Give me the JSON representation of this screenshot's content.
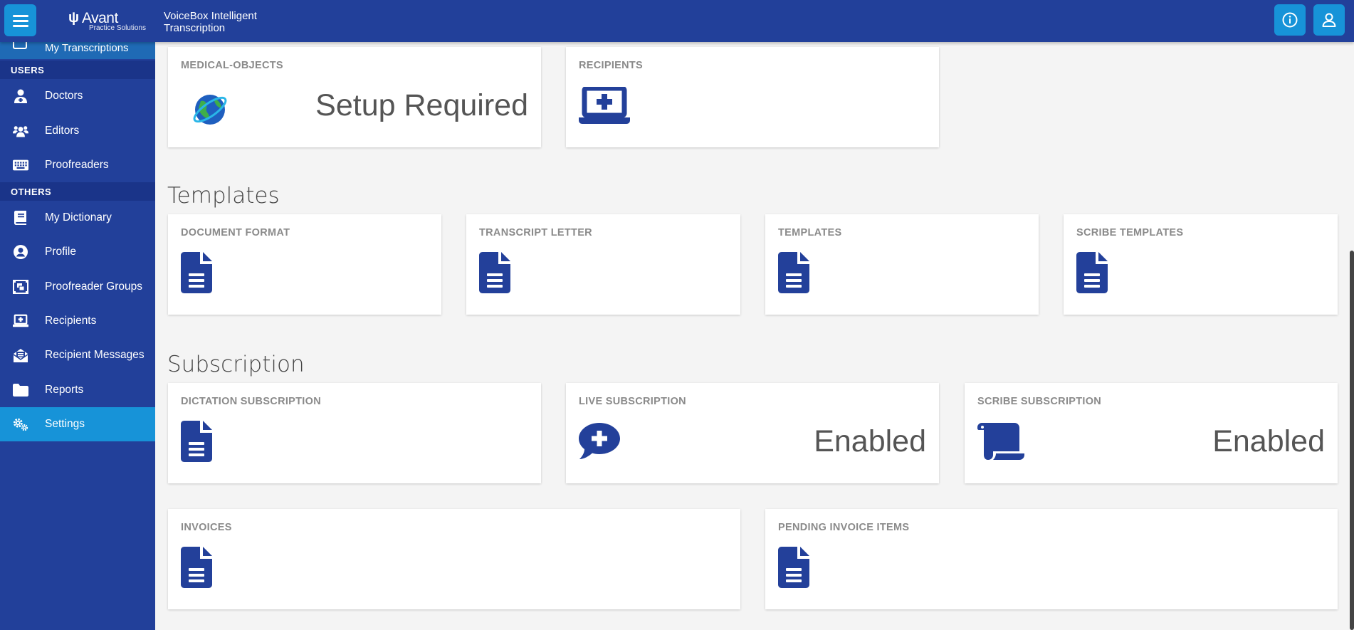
{
  "header": {
    "logo_name": "Avant",
    "logo_sub": "Practice Solutions",
    "app_title": "VoiceBox Intelligent Transcription",
    "menu_icon": "hamburger-icon",
    "info_icon": "info-icon",
    "user_icon": "user-icon"
  },
  "sidebar": {
    "partial_item": "My Transcriptions",
    "users_header": "USERS",
    "users_items": [
      {
        "label": "Doctors",
        "icon": "user-md-icon"
      },
      {
        "label": "Editors",
        "icon": "users-icon"
      },
      {
        "label": "Proofreaders",
        "icon": "keyboard-icon"
      }
    ],
    "others_header": "OTHERS",
    "others_items": [
      {
        "label": "My Dictionary",
        "icon": "book-icon"
      },
      {
        "label": "Profile",
        "icon": "user-circle-icon"
      },
      {
        "label": "Proofreader Groups",
        "icon": "object-group-icon"
      },
      {
        "label": "Recipients",
        "icon": "laptop-medical-icon"
      },
      {
        "label": "Recipient Messages",
        "icon": "envelope-open-icon"
      },
      {
        "label": "Reports",
        "icon": "folder-icon"
      },
      {
        "label": "Settings",
        "icon": "cogs-icon"
      }
    ],
    "active_item": "Settings"
  },
  "top_cards": [
    {
      "title": "MEDICAL-OBJECTS",
      "value": "Setup Required",
      "icon": "globe-logo-icon"
    },
    {
      "title": "RECIPIENTS",
      "value": "",
      "icon": "laptop-medical-icon"
    }
  ],
  "templates": {
    "section_title": "Templates",
    "cards": [
      {
        "title": "DOCUMENT FORMAT",
        "icon": "file-alt-icon"
      },
      {
        "title": "TRANSCRIPT LETTER",
        "icon": "file-alt-icon"
      },
      {
        "title": "TEMPLATES",
        "icon": "file-alt-icon"
      },
      {
        "title": "SCRIBE TEMPLATES",
        "icon": "file-alt-icon"
      }
    ]
  },
  "subscription": {
    "section_title": "Subscription",
    "cards": [
      {
        "title": "DICTATION SUBSCRIPTION",
        "value": "",
        "icon": "file-alt-icon"
      },
      {
        "title": "LIVE SUBSCRIPTION",
        "value": "Enabled",
        "icon": "comment-medical-icon"
      },
      {
        "title": "SCRIBE SUBSCRIPTION",
        "value": "Enabled",
        "icon": "scroll-icon"
      }
    ],
    "invoice_cards": [
      {
        "title": "INVOICES",
        "icon": "file-alt-icon"
      },
      {
        "title": "PENDING INVOICE ITEMS",
        "icon": "file-alt-icon"
      }
    ]
  },
  "colors": {
    "primary": "#22409a",
    "accent": "#1793d8",
    "icon_blue": "#23409a",
    "background": "#f4f4f4"
  }
}
